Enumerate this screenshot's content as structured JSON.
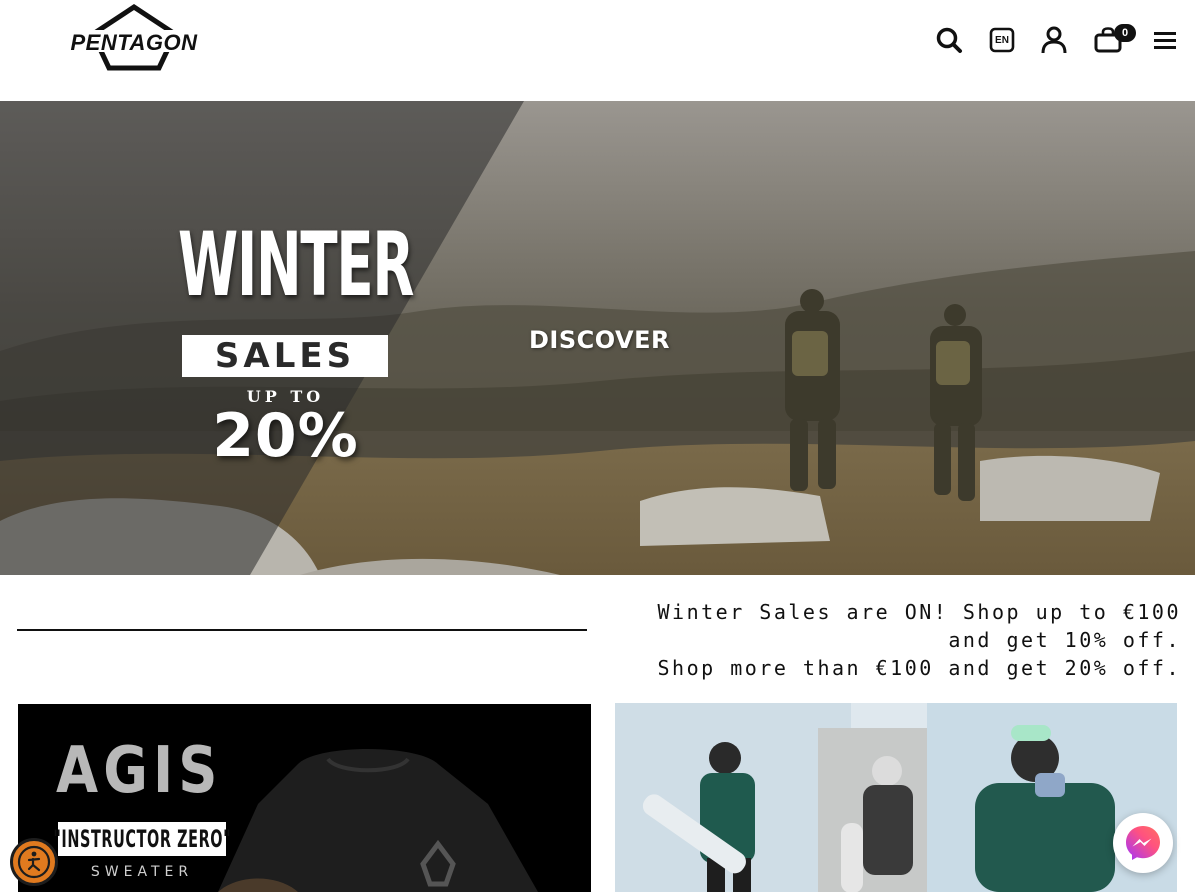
{
  "header": {
    "logo_text": "PENTAGON",
    "language_label": "EN",
    "cart_count": "0"
  },
  "hero": {
    "promo_line1": "WINTER",
    "promo_line2": "SALES",
    "promo_line3": "UP TO",
    "promo_line4": "20%",
    "cta_label": "DISCOVER"
  },
  "announcement": {
    "line1": "Winter Sales are ON! Shop up to €100",
    "line2": "and get 10% off.",
    "line3": "Shop more than €100 and get 20% off."
  },
  "products": {
    "left_tile": {
      "brand": "AGIS",
      "name": "\"INSTRUCTOR ZERO\"",
      "type": "SWEATER"
    }
  },
  "icons": {
    "search": "search-icon",
    "language": "language-icon",
    "account": "user-icon",
    "cart": "shopping-bag-icon",
    "menu": "hamburger-menu-icon",
    "accessibility": "accessibility-icon",
    "chat": "messenger-icon"
  },
  "colors": {
    "accessibility_bg": "#e07a1f",
    "messenger_gradient_start": "#ff5f6d",
    "messenger_gradient_end": "#a033ff"
  }
}
